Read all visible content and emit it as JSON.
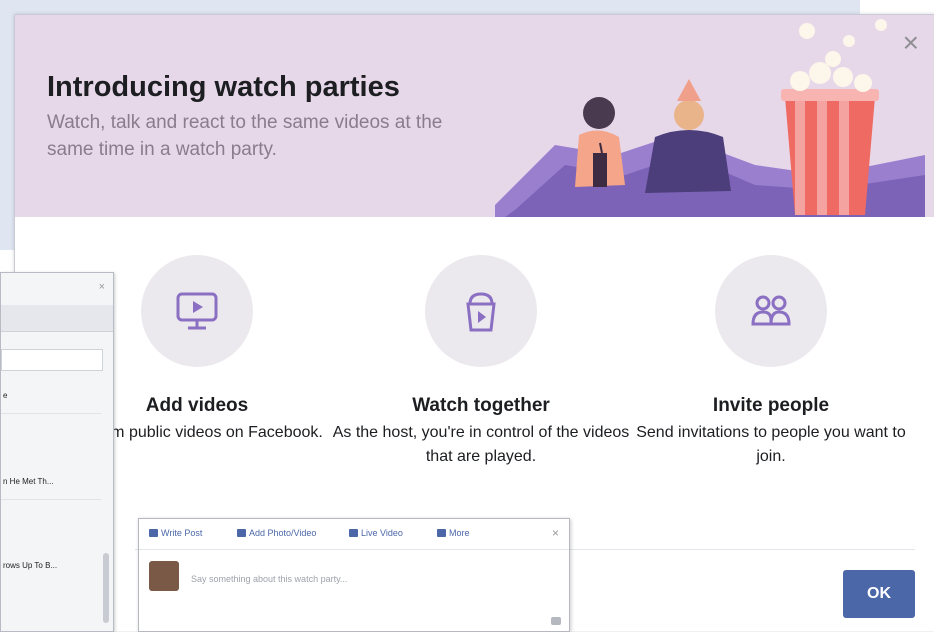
{
  "modal": {
    "title": "Introducing watch parties",
    "subtitle": "Watch, talk and react to the same videos at the same time in a watch party.",
    "close_label": "×",
    "features": [
      {
        "title": "Add videos",
        "description": "se from public videos on Facebook.",
        "icon": "video-screen-icon"
      },
      {
        "title": "Watch together",
        "description": "As the host, you're in control of the videos that are played.",
        "icon": "popcorn-play-icon"
      },
      {
        "title": "Invite people",
        "description": "Send invitations to people you want to join.",
        "icon": "people-icon"
      }
    ],
    "ok_label": "OK"
  },
  "side_window": {
    "close_label": "×",
    "items": [
      "e",
      "n He Met Th...",
      "rows Up To B..."
    ]
  },
  "composer": {
    "tabs": [
      "Write Post",
      "Add Photo/Video",
      "Live Video",
      "More"
    ],
    "close_label": "×",
    "placeholder": "Say something about this watch party..."
  },
  "colors": {
    "hero_bg": "#e7d8e9",
    "ok_button": "#4b67a8",
    "icon_circle": "#ebe9ee",
    "icon_stroke": "#8b6fc2"
  }
}
